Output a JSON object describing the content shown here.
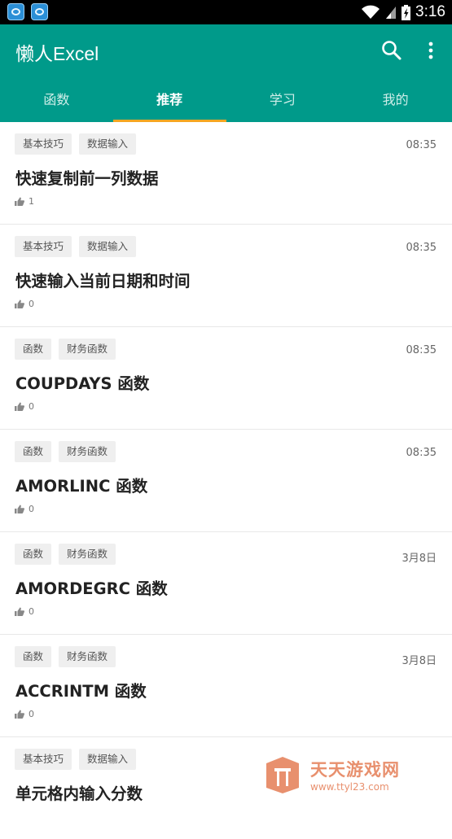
{
  "status_bar": {
    "time": "3:16"
  },
  "app_bar": {
    "title": "懒人Excel",
    "search_icon": "search-icon",
    "more_icon": "more-vert-icon",
    "background": "#009a8a"
  },
  "tabs": [
    {
      "label": "函数"
    },
    {
      "label": "推荐"
    },
    {
      "label": "学习"
    },
    {
      "label": "我的"
    }
  ],
  "active_tab": "推荐",
  "articles": [
    {
      "tags": [
        "基本技巧",
        "数据输入"
      ],
      "time": "08:35",
      "title": "快速复制前一列数据",
      "likes": "1"
    },
    {
      "tags": [
        "基本技巧",
        "数据输入"
      ],
      "time": "08:35",
      "title": "快速输入当前日期和时间",
      "likes": "0"
    },
    {
      "tags": [
        "函数",
        "财务函数"
      ],
      "time": "08:35",
      "title": "COUPDAYS 函数",
      "likes": "0"
    },
    {
      "tags": [
        "函数",
        "财务函数"
      ],
      "time": "08:35",
      "title": "AMORLINC 函数",
      "likes": "0"
    },
    {
      "tags": [
        "函数",
        "财务函数"
      ],
      "time": "3月8日",
      "title": "AMORDEGRC 函数",
      "likes": "0"
    },
    {
      "tags": [
        "函数",
        "财务函数"
      ],
      "time": "3月8日",
      "title": "ACCRINTM 函数",
      "likes": "0"
    },
    {
      "tags": [
        "基本技巧",
        "数据输入"
      ],
      "time": "",
      "title": "单元格内输入分数",
      "likes": ""
    }
  ],
  "watermark": {
    "name": "天天游戏网",
    "url": "www.ttyl23.com"
  },
  "colors": {
    "accent": "#009a8a",
    "indicator": "#f5a623",
    "watermark": "#e3754a"
  }
}
